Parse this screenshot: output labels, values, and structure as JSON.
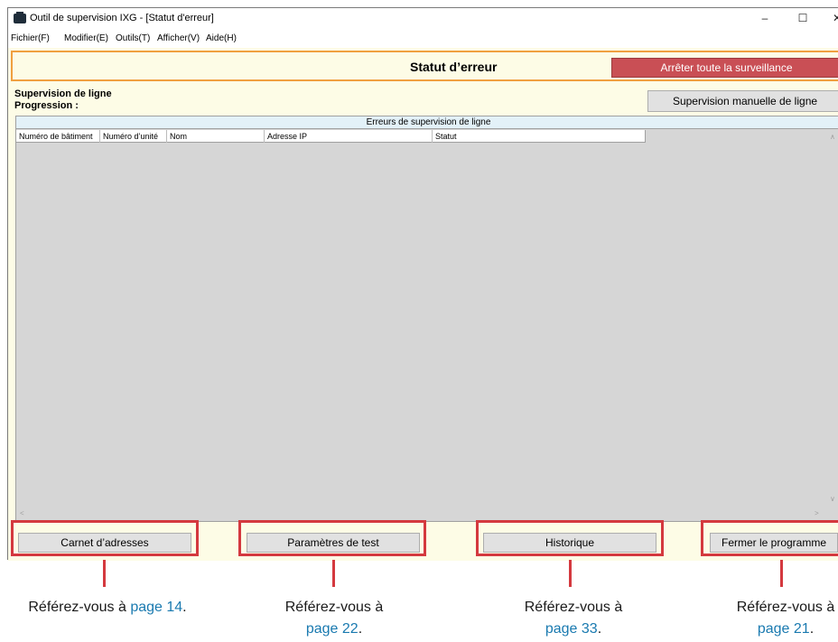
{
  "window": {
    "title": "Outil de supervision IXG - [Statut d'erreur]",
    "controls": {
      "minimize": "–",
      "maximize": "☐",
      "close": "✕"
    }
  },
  "menu": [
    "Fichier(F)",
    "Modifier(E)",
    "Outils(T)",
    "Afficher(V)",
    "Aide(H)"
  ],
  "header": {
    "title": "Statut d’erreur",
    "stop_all_label": "Arrêter toute la surveillance"
  },
  "supervision": {
    "line_label": "Supervision de ligne",
    "progress_label": "Progression :",
    "manual_button": "Supervision manuelle de ligne"
  },
  "errors_table": {
    "title": "Erreurs de supervision de ligne",
    "columns": [
      "Numéro de bâtiment",
      "Numéro d’unité",
      "Nom",
      "Adresse IP",
      "Statut"
    ],
    "rows": []
  },
  "buttons": {
    "address_book": "Carnet d’adresses",
    "test_params": "Paramètres de test",
    "history": "Historique",
    "close_program": "Fermer le programme"
  },
  "callouts": {
    "refer": "Référez-vous à",
    "address_book_page": "page 14",
    "test_params_page": "page 22",
    "history_page": "page 33",
    "close_program_page": "page 21",
    "period": "."
  },
  "colors": {
    "accent_red": "#d4393f",
    "stop_button": "#c94f55",
    "client_bg": "#fdfce6",
    "header_border": "#f0a040",
    "link": "#1a7ab0"
  }
}
